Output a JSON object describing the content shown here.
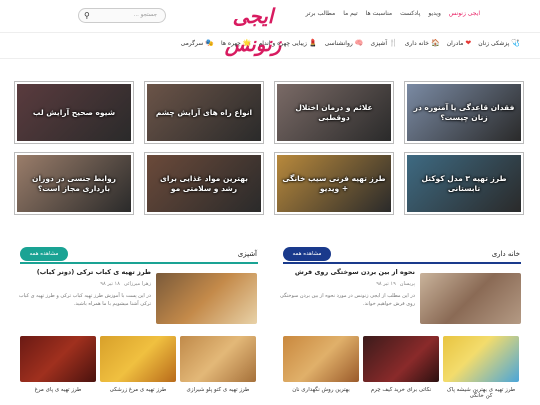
{
  "site": {
    "logo": "ایجی زنونس"
  },
  "top_nav": [
    "ایجی زنونس",
    "ویدیو",
    "پادکست",
    "مناسبت ها",
    "تیم ما",
    "مطالب برتر"
  ],
  "search": {
    "placeholder": "جستجو ..."
  },
  "category_nav": [
    {
      "label": "پزشکی زنان",
      "icon": "🩺"
    },
    {
      "label": "مادران",
      "icon": "❤"
    },
    {
      "label": "خانه داری",
      "icon": "🏠"
    },
    {
      "label": "آشپزی",
      "icon": "🍴"
    },
    {
      "label": "روانشناسی",
      "icon": "🧠"
    },
    {
      "label": "زیبایی چهره و اندام",
      "icon": "💄"
    },
    {
      "label": "چهره ها",
      "icon": "🌟"
    },
    {
      "label": "سرگرمی",
      "icon": "🎭"
    }
  ],
  "tiles": [
    {
      "title": "فقدان قاعدگی یا آمنوره در زنان چیست؟",
      "color": "#7a8aa3"
    },
    {
      "title": "علائم و درمان اختلال دوقطبی",
      "color": "#7a6a66"
    },
    {
      "title": "انواع راه های آرایش چشم",
      "color": "#6b5448"
    },
    {
      "title": "شیوه صحیح آرایش لب",
      "color": "#5a3b3e"
    },
    {
      "title": "طرز تهیه ۳ مدل کوکتل تابستانی",
      "color": "#3e6a82"
    },
    {
      "title": "طرز تهیه فرنی سیب خانگی + ویدیو",
      "color": "#b8893c"
    },
    {
      "title": "بهترین مواد غذایی برای رشد و سلامتی مو",
      "color": "#6b4a3a"
    },
    {
      "title": "روابط جنسی در دوران بارداری مجاز است؟",
      "color": "#9a7d6a"
    }
  ],
  "home_section": {
    "title": "خانه داری",
    "more": "مشاهده همه",
    "accent": "#1a3a8c",
    "featured": {
      "title": "نحوه از بین بردن سوختگی روی فرش",
      "author": "پریسان",
      "date": "۱۹ تیر ۹۸",
      "desc": "در این مطلب از ایجی زنونس در مورد نحوه از بین بردن سوختگی روی فرش خواهیم خواند."
    },
    "thumbs": [
      "بهترین روش نگهداری نان",
      "نکاتی برای خرید کیف چرم",
      "طرز تهیه ی بهترین شیشه پاک کن خانگی"
    ]
  },
  "cook_section": {
    "title": "آشپزی",
    "more": "مشاهده همه",
    "accent": "#1aa394",
    "featured": {
      "title": "طرز تهیه ی کباب ترکی (دونر کباب)",
      "author": "زهرا میرزائی",
      "date": "۱۸ تیر ۹۸",
      "desc": "در این پست با آموزش طرز تهیه کباب ترکی و طرز تهیه ی کباب ترکی آشنا میشویم با ما همراه باشید."
    },
    "thumbs": [
      "طرز تهیه ی کتو پلو شیرازی",
      "طرز تهیه ی مرغ زرشکی",
      "طرز تهیه ی پای مرغ"
    ]
  }
}
